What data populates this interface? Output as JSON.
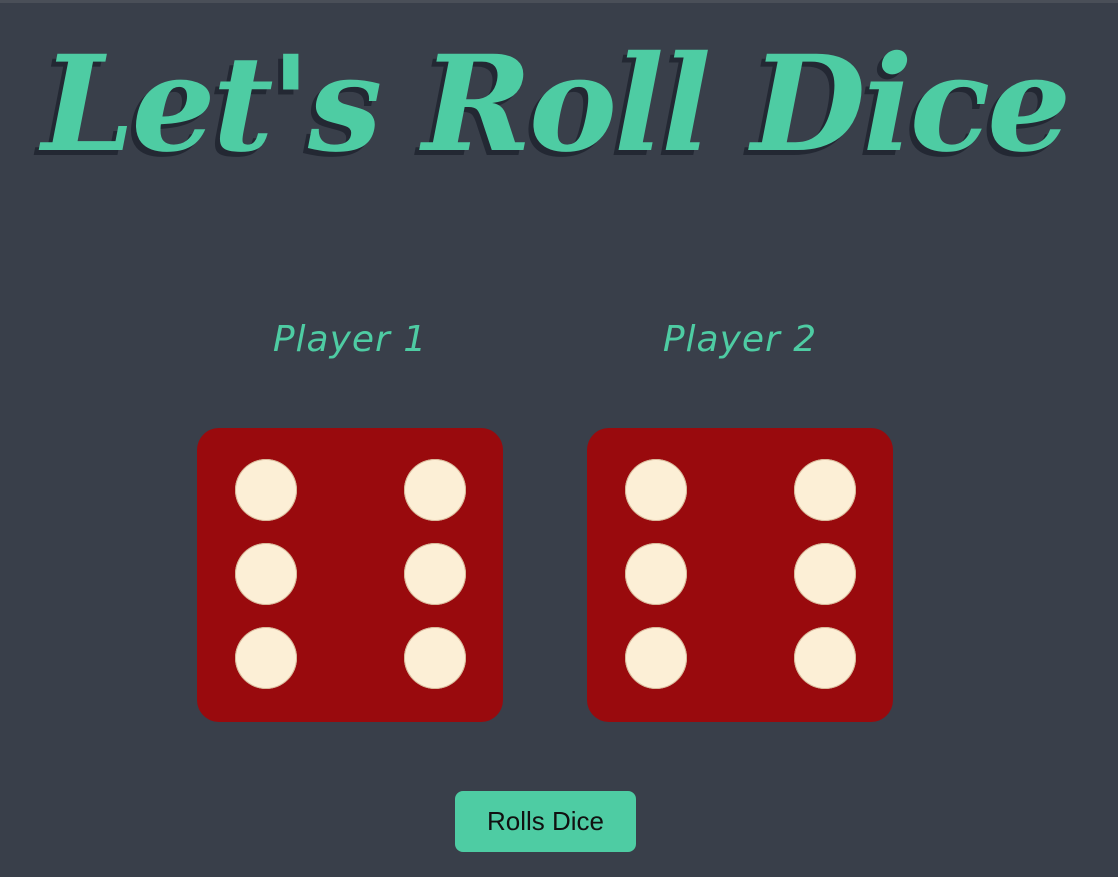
{
  "header": {
    "title": "Let's Roll Dice"
  },
  "players": [
    {
      "label": "Player 1",
      "die_value": 6
    },
    {
      "label": "Player 2",
      "die_value": 6
    }
  ],
  "controls": {
    "roll_button_label": "Rolls Dice"
  },
  "colors": {
    "background": "#393f4a",
    "accent": "#4ecca3",
    "die_face": "#990a0d",
    "pip": "#fcefd6"
  }
}
